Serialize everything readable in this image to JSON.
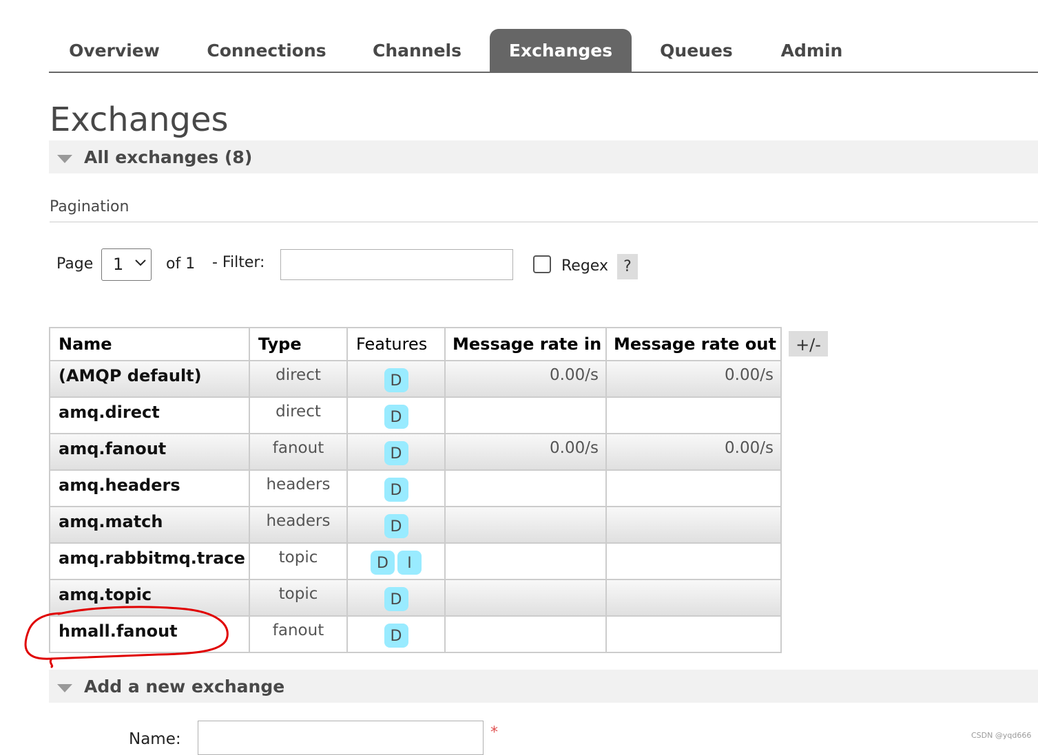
{
  "nav": {
    "tabs": [
      {
        "label": "Overview",
        "active": false
      },
      {
        "label": "Connections",
        "active": false
      },
      {
        "label": "Channels",
        "active": false
      },
      {
        "label": "Exchanges",
        "active": true
      },
      {
        "label": "Queues",
        "active": false
      },
      {
        "label": "Admin",
        "active": false
      }
    ]
  },
  "page": {
    "title": "Exchanges"
  },
  "all_exchanges": {
    "label": "All exchanges (8)"
  },
  "pagination": {
    "title": "Pagination",
    "page_label": "Page",
    "page_value": "1",
    "of_label": "of 1",
    "filter_label": "- Filter:",
    "filter_value": "",
    "regex_label": "Regex",
    "regex_checked": false,
    "help_label": "?"
  },
  "table": {
    "headers": [
      "Name",
      "Type",
      "Features",
      "Message rate in",
      "Message rate out"
    ],
    "columns_toggle": "+/-",
    "rows": [
      {
        "name": "(AMQP default)",
        "type": "direct",
        "features": [
          "D"
        ],
        "rate_in": "0.00/s",
        "rate_out": "0.00/s"
      },
      {
        "name": "amq.direct",
        "type": "direct",
        "features": [
          "D"
        ],
        "rate_in": "",
        "rate_out": ""
      },
      {
        "name": "amq.fanout",
        "type": "fanout",
        "features": [
          "D"
        ],
        "rate_in": "0.00/s",
        "rate_out": "0.00/s"
      },
      {
        "name": "amq.headers",
        "type": "headers",
        "features": [
          "D"
        ],
        "rate_in": "",
        "rate_out": ""
      },
      {
        "name": "amq.match",
        "type": "headers",
        "features": [
          "D"
        ],
        "rate_in": "",
        "rate_out": ""
      },
      {
        "name": "amq.rabbitmq.trace",
        "type": "topic",
        "features": [
          "D",
          "I"
        ],
        "rate_in": "",
        "rate_out": ""
      },
      {
        "name": "amq.topic",
        "type": "topic",
        "features": [
          "D"
        ],
        "rate_in": "",
        "rate_out": ""
      },
      {
        "name": "hmall.fanout",
        "type": "fanout",
        "features": [
          "D"
        ],
        "rate_in": "",
        "rate_out": ""
      }
    ]
  },
  "add_exchange": {
    "label": "Add a new exchange",
    "name_label": "Name:",
    "name_value": "",
    "required_mark": "*"
  },
  "watermark": "CSDN @yqd666",
  "colors": {
    "nav_active_bg": "#666666",
    "feature_badge": "#99ebff",
    "annotation": "#e00000",
    "section_bg": "#f1f1f1"
  },
  "icons": {
    "section_toggle": "triangle-down-icon",
    "select_arrow": "chevron-down-icon"
  }
}
